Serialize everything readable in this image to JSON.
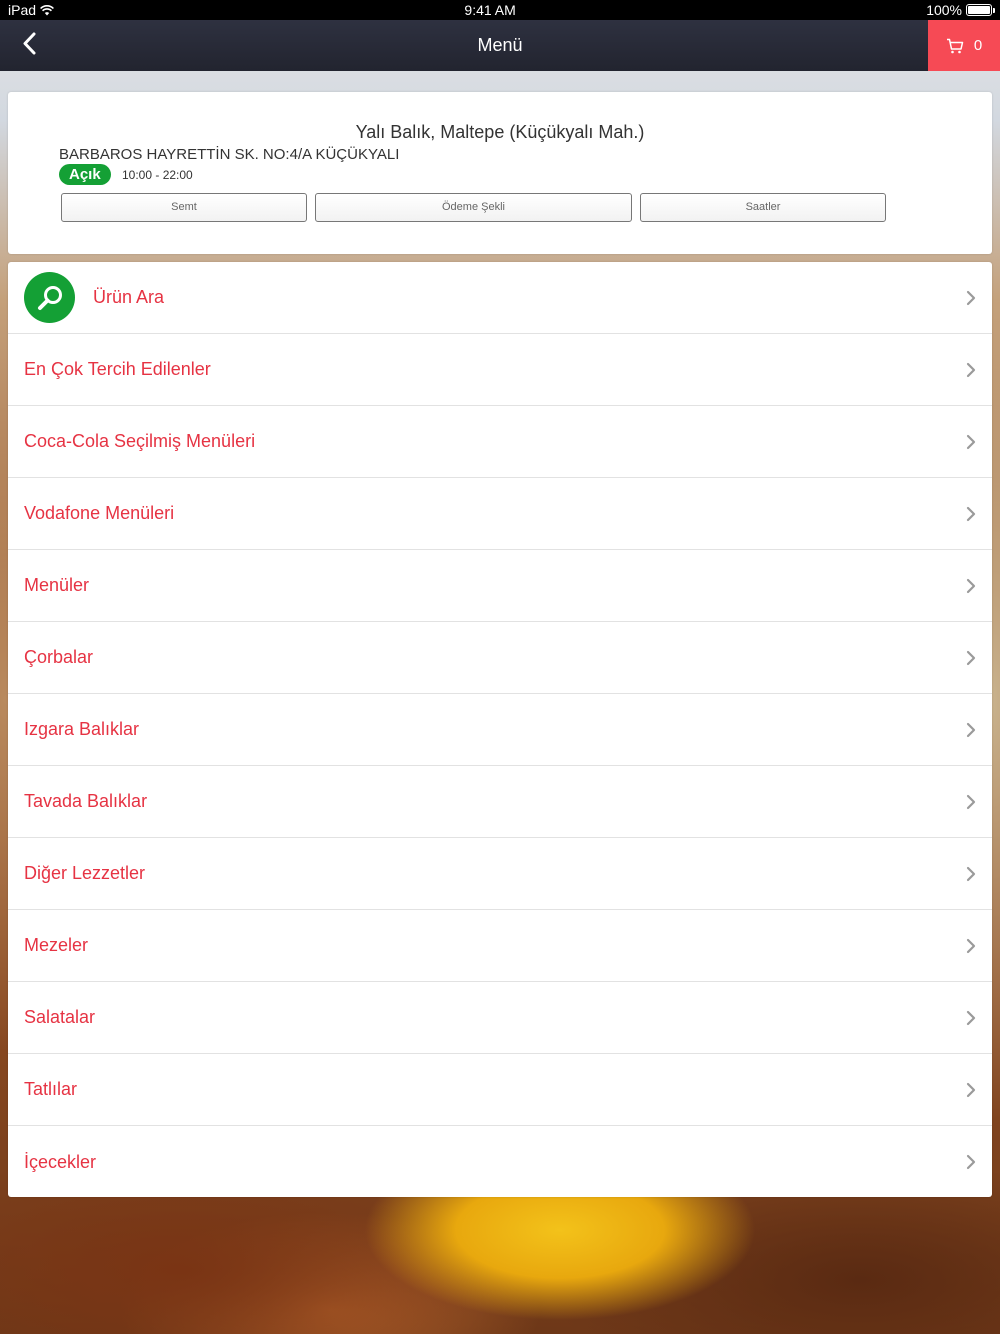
{
  "status_bar": {
    "device": "iPad",
    "time": "9:41 AM",
    "battery": "100%"
  },
  "nav": {
    "title": "Menü",
    "cart_count": "0"
  },
  "restaurant": {
    "name": "Yalı Balık, Maltepe (Küçükyalı Mah.)",
    "address": "BARBAROS HAYRETTİN SK. NO:4/A KÜÇÜKYALI",
    "status": "Açık",
    "hours": "10:00 - 22:00",
    "buttons": {
      "district": "Semt",
      "payment": "Ödeme Şekli",
      "hours": "Saatler"
    }
  },
  "menu": {
    "search_label": "Ürün Ara",
    "categories": [
      "En Çok Tercih Edilenler",
      "Coca-Cola Seçilmiş Menüleri",
      "Vodafone Menüleri",
      "Menüler",
      "Çorbalar",
      "Izgara Balıklar",
      "Tavada Balıklar",
      "Diğer Lezzetler",
      "Mezeler",
      "Salatalar",
      "Tatlılar",
      "İçecekler"
    ]
  },
  "colors": {
    "accent_red": "#e63343",
    "cart_red": "#f64a55",
    "open_green": "#14a035",
    "navbar": "#2a2c38"
  }
}
